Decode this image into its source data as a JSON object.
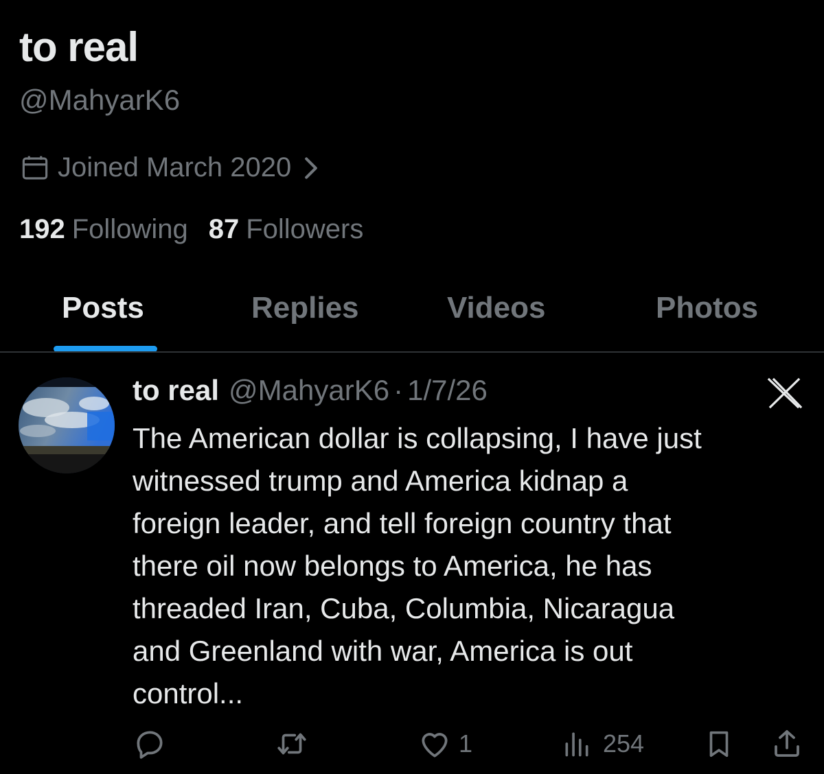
{
  "profile": {
    "display_name": "to real",
    "handle": "@MahyarK6",
    "joined": "Joined March 2020",
    "following_count": "192",
    "following_label": "Following",
    "followers_count": "87",
    "followers_label": "Followers"
  },
  "tabs": [
    {
      "label": "Posts",
      "active": true
    },
    {
      "label": "Replies",
      "active": false
    },
    {
      "label": "Videos",
      "active": false
    },
    {
      "label": "Photos",
      "active": false
    }
  ],
  "post": {
    "author_name": "to real",
    "author_handle": "@MahyarK6",
    "separator": "·",
    "date": "1/7/26",
    "text_lines": [
      "The American dollar is collapsing, I have just",
      "witnessed trump and America kidnap a",
      "foreign leader, and tell foreign country that",
      "there oil now belongs to America, he has",
      "threaded Iran, Cuba, Columbia, Nicaragua",
      "and Greenland with war, America is out",
      "control..."
    ],
    "likes": "1",
    "views": "254"
  },
  "icons": {
    "calendar": "calendar-icon",
    "chevron": "chevron-right-icon",
    "x_logo": "x-logo-icon",
    "reply": "reply-icon",
    "repost": "repost-icon",
    "like": "heart-icon",
    "views": "views-icon",
    "bookmark": "bookmark-icon",
    "share": "share-icon"
  },
  "colors": {
    "background": "#000000",
    "primary_text": "#e7e9ea",
    "secondary_text": "#71767b",
    "accent": "#1d9bf0",
    "divider": "#2f3336"
  }
}
